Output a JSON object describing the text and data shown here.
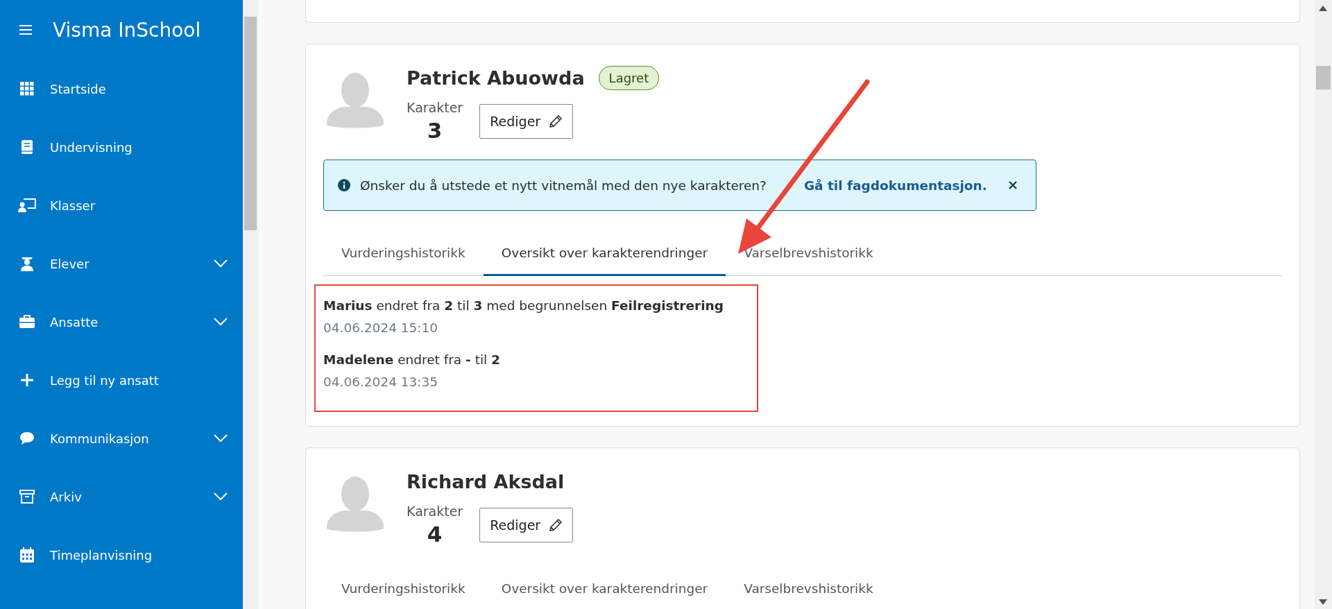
{
  "sidebar": {
    "title": "Visma InSchool",
    "items": [
      {
        "label": "Startside",
        "expandable": false
      },
      {
        "label": "Undervisning",
        "expandable": false
      },
      {
        "label": "Klasser",
        "expandable": false
      },
      {
        "label": "Elever",
        "expandable": true
      },
      {
        "label": "Ansatte",
        "expandable": true
      },
      {
        "label": "Legg til ny ansatt",
        "expandable": false
      },
      {
        "label": "Kommunikasjon",
        "expandable": true
      },
      {
        "label": "Arkiv",
        "expandable": true
      },
      {
        "label": "Timeplanvisning",
        "expandable": false
      }
    ]
  },
  "students": [
    {
      "name": "Patrick Abuowda",
      "badge": "Lagret",
      "grade_label": "Karakter",
      "grade": "3",
      "edit_button": "Rediger",
      "alert": {
        "text": "Ønsker du å utstede et nytt vitnemål med den nye karakteren?",
        "link": "Gå til fagdokumentasjon."
      },
      "tabs": [
        {
          "label": "Vurderingshistorikk",
          "selected": false
        },
        {
          "label": "Oversikt over karakterendringer",
          "selected": true
        },
        {
          "label": "Varselbrevshistorikk",
          "selected": false
        }
      ],
      "history": [
        {
          "text": "**Marius** endret fra **2** til **3** med begrunnelsen **Feilregistrering**",
          "time": "04.06.2024 15:10"
        },
        {
          "text": "**Madelene** endret fra **-** til **2**",
          "time": "04.06.2024 13:35"
        }
      ]
    },
    {
      "name": "Richard Aksdal",
      "grade_label": "Karakter",
      "grade": "4",
      "edit_button": "Rediger",
      "tabs": [
        {
          "label": "Vurderingshistorikk",
          "selected": false
        },
        {
          "label": "Oversikt over karakterendringer",
          "selected": false
        },
        {
          "label": "Varselbrevshistorikk",
          "selected": false
        }
      ]
    }
  ]
}
